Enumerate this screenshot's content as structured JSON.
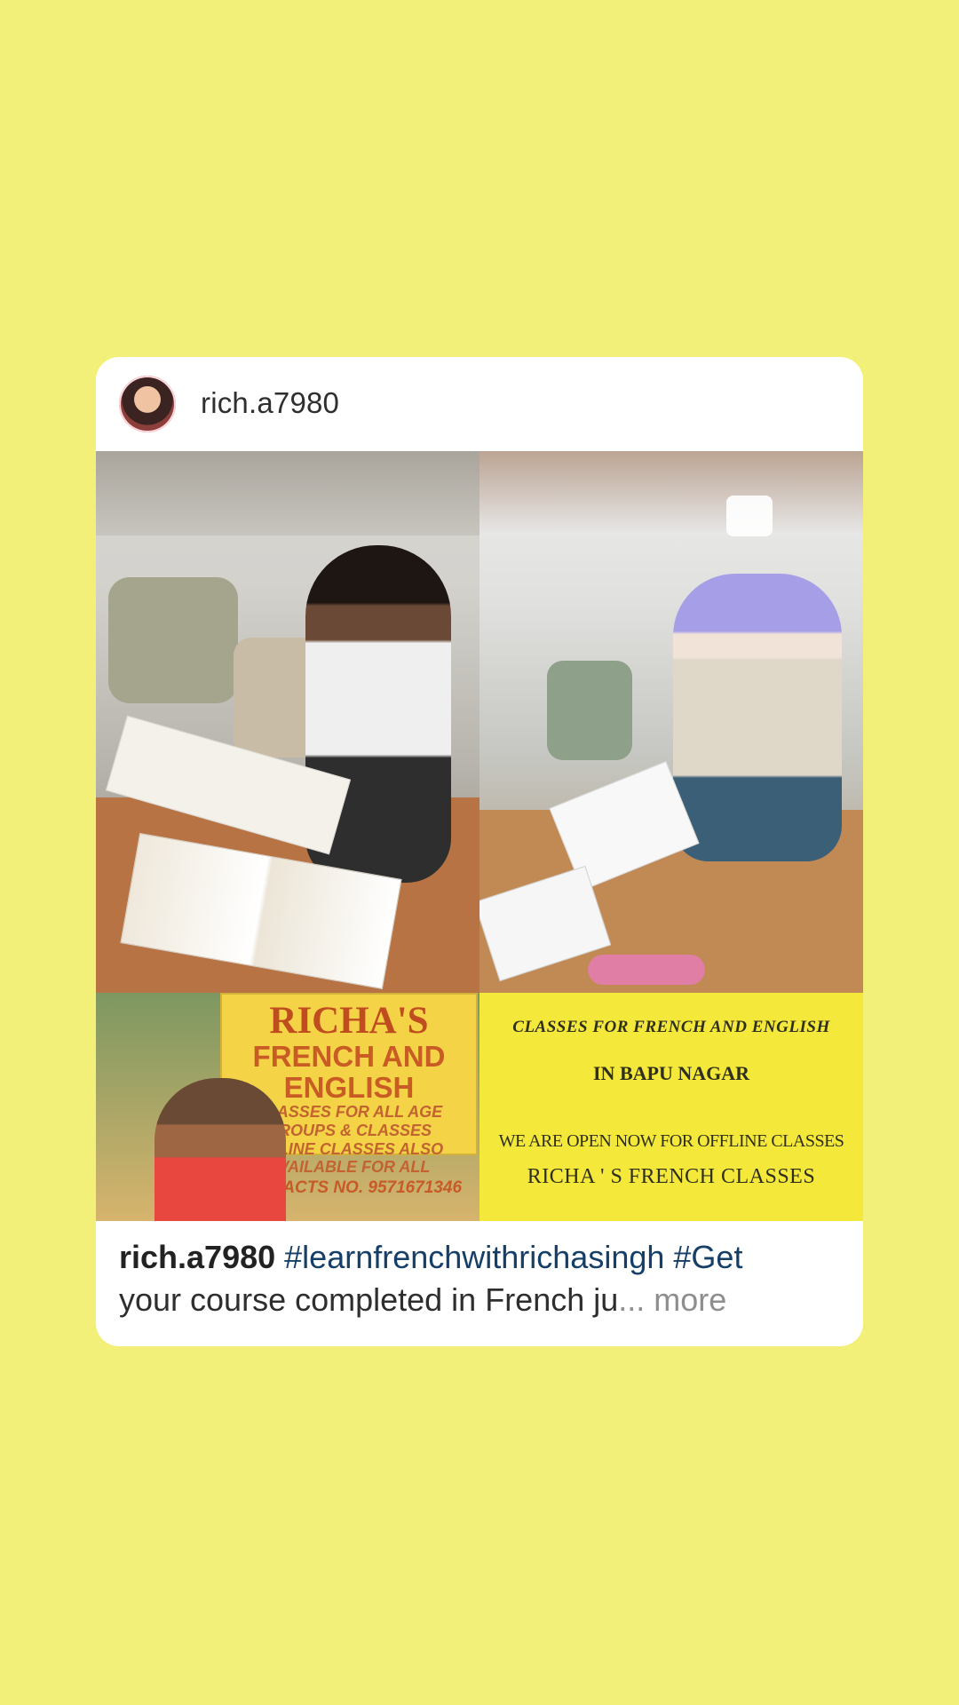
{
  "post": {
    "username": "rich.a7980",
    "caption_username": "rich.a7980",
    "caption_hashtags": "#learnfrenchwithrichasingh #Get",
    "caption_text": "your course completed in French  ju",
    "caption_more": "... more"
  },
  "collage": {
    "sign_title": "RICHA'S",
    "sign_sub": "FRENCH AND ENGLISH",
    "sign_line1": "CLASSES FOR ALL AGE GROUPS & CLASSES",
    "sign_line2": "ONLINE CLASSES ALSO AVAILABLE FOR ALL",
    "sign_contact": "CONTACTS NO. 9571671346",
    "flyer_line1": "CLASSES FOR FRENCH AND ENGLISH",
    "flyer_line2": "IN BAPU NAGAR",
    "flyer_line3": "WE ARE OPEN NOW FOR OFFLINE CLASSES",
    "flyer_line4": "RICHA ' S FRENCH CLASSES"
  },
  "icons": {
    "avatar": "profile-avatar",
    "selector": "checkbox-icon"
  },
  "colors": {
    "background": "#f3f07a",
    "card": "#ffffff",
    "hashtag": "#163f68",
    "muted": "#8e8e8e"
  }
}
